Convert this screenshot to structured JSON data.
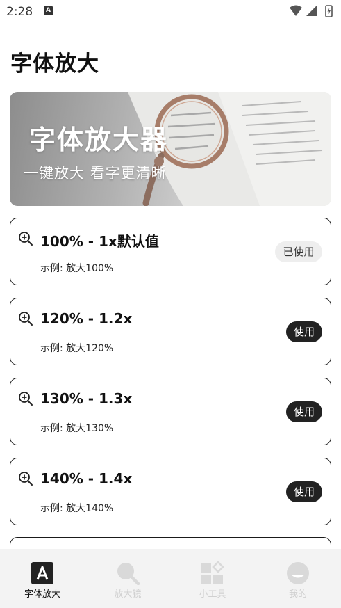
{
  "status_bar": {
    "time": "2:28",
    "notif_letter": "A"
  },
  "page_title": "字体放大",
  "banner": {
    "title": "字体放大器",
    "subtitle": "一键放大 看字更清晰"
  },
  "options": [
    {
      "title": "100% - 1x默认值",
      "example": "示例: 放大100%",
      "button": "已使用",
      "in_use": true
    },
    {
      "title": "120% - 1.2x",
      "example": "示例: 放大120%",
      "button": "使用",
      "in_use": false
    },
    {
      "title": "130% - 1.3x",
      "example": "示例: 放大130%",
      "button": "使用",
      "in_use": false
    },
    {
      "title": "140% - 1.4x",
      "example": "示例: 放大140%",
      "button": "使用",
      "in_use": false
    }
  ],
  "bottom_nav": [
    {
      "label": "字体放大",
      "icon": "font-a-icon",
      "active": true
    },
    {
      "label": "放大镜",
      "icon": "magnifier-icon",
      "active": false
    },
    {
      "label": "小工具",
      "icon": "widgets-icon",
      "active": false
    },
    {
      "label": "我的",
      "icon": "profile-icon",
      "active": false
    }
  ],
  "colors": {
    "dark": "#222222",
    "inactive": "#d0d0d0",
    "nav_bg": "#f3f3f3"
  }
}
